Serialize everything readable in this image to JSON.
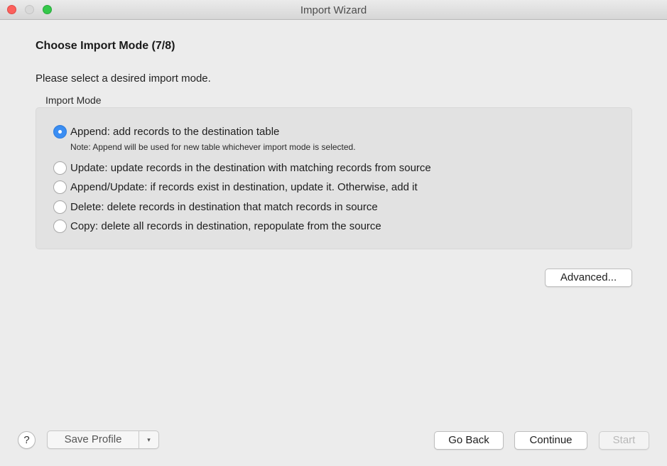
{
  "window": {
    "title": "Import Wizard"
  },
  "page": {
    "title": "Choose Import Mode (7/8)",
    "instruction": "Please select a desired import mode."
  },
  "import_mode": {
    "group_label": "Import Mode",
    "selected_index": 0,
    "options": [
      {
        "label": "Append: add records to the destination table",
        "checked": true
      },
      {
        "label": "Update: update records in the destination with matching records from source",
        "checked": false
      },
      {
        "label": "Append/Update: if records exist in destination, update it. Otherwise, add it",
        "checked": false
      },
      {
        "label": "Delete: delete records in destination that match records in source",
        "checked": false
      },
      {
        "label": "Copy: delete all records in destination, repopulate from the source",
        "checked": false
      }
    ],
    "note": "Note: Append will be used for new table whichever import mode is selected."
  },
  "buttons": {
    "advanced": "Advanced...",
    "help": "?",
    "save_profile": "Save Profile",
    "save_profile_arrow": "▾",
    "go_back": "Go Back",
    "continue": "Continue",
    "start": "Start",
    "start_enabled": false
  },
  "colors": {
    "accent": "#3b8ef3",
    "window_bg": "#ececec",
    "group_bg": "#e2e2e2",
    "close": "#fc605c",
    "minimize": "#d9d9d9",
    "maximize": "#34c84a"
  }
}
